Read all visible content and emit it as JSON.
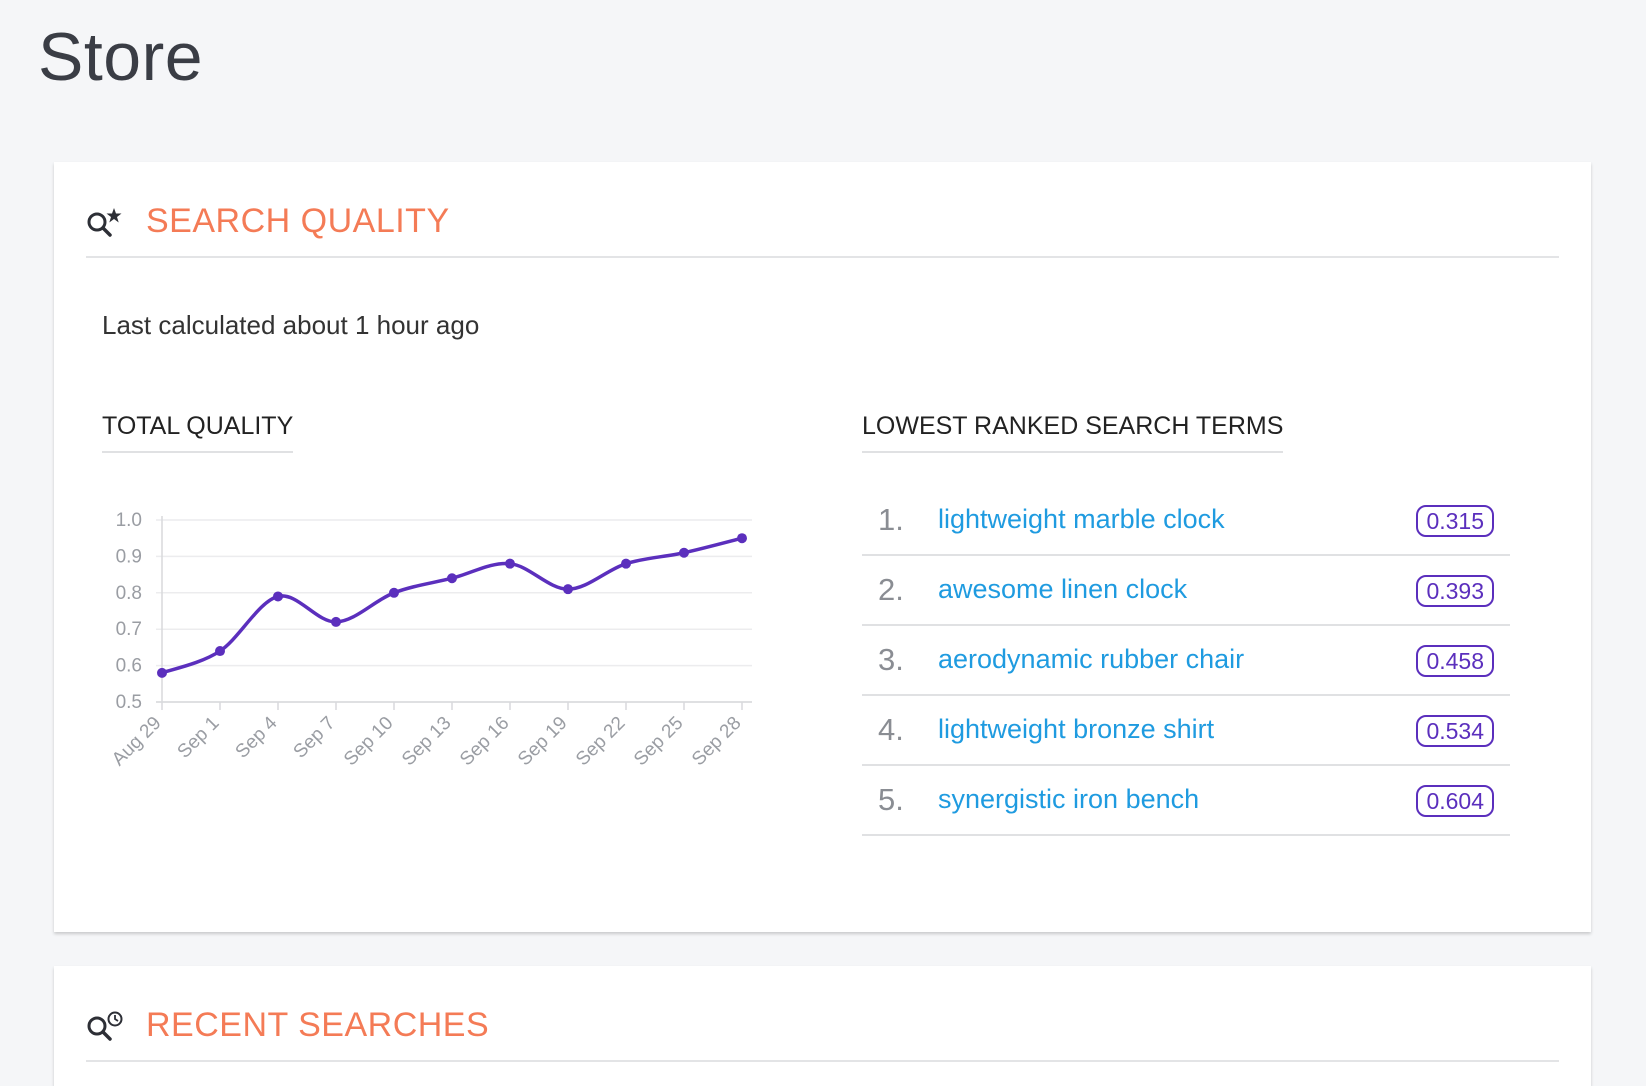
{
  "page": {
    "title": "Store"
  },
  "search_quality": {
    "title": "SEARCH QUALITY",
    "last_calculated": "Last calculated about 1 hour ago",
    "total_quality_label": "TOTAL QUALITY",
    "lowest_terms_label": "LOWEST RANKED SEARCH TERMS",
    "terms": [
      {
        "rank": "1.",
        "term": "lightweight marble clock",
        "score": "0.315"
      },
      {
        "rank": "2.",
        "term": "awesome linen clock",
        "score": "0.393"
      },
      {
        "rank": "3.",
        "term": "aerodynamic rubber chair",
        "score": "0.458"
      },
      {
        "rank": "4.",
        "term": "lightweight bronze shirt",
        "score": "0.534"
      },
      {
        "rank": "5.",
        "term": "synergistic iron bench",
        "score": "0.604"
      }
    ]
  },
  "recent_searches": {
    "title": "RECENT SEARCHES"
  },
  "colors": {
    "accent": "#f47b56",
    "line": "#5b2fbd",
    "link": "#1f9be0"
  },
  "chart_data": {
    "type": "line",
    "categories": [
      "Aug 29",
      "Sep 1",
      "Sep 4",
      "Sep 7",
      "Sep 10",
      "Sep 13",
      "Sep 16",
      "Sep 19",
      "Sep 22",
      "Sep 25",
      "Sep 28"
    ],
    "values": [
      0.58,
      0.64,
      0.79,
      0.72,
      0.8,
      0.84,
      0.88,
      0.81,
      0.88,
      0.91,
      0.95
    ],
    "yticks": [
      "1.0",
      "0.9",
      "0.8",
      "0.7",
      "0.6",
      "0.5"
    ],
    "ylim": [
      0.5,
      1.0
    ],
    "grid": true
  }
}
